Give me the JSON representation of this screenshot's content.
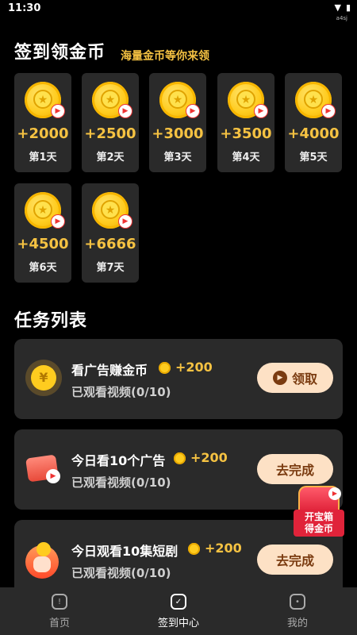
{
  "status": {
    "time": "11:30",
    "wifi_icon": "wifi-icon",
    "battery_icon": "battery-icon",
    "small_text": "a4sj"
  },
  "checkin": {
    "title": "签到领金币",
    "subtitle": "海量金币等你来领",
    "days": [
      {
        "amount": "+2000",
        "label": "第1天"
      },
      {
        "amount": "+2500",
        "label": "第2天"
      },
      {
        "amount": "+3000",
        "label": "第3天"
      },
      {
        "amount": "+3500",
        "label": "第4天"
      },
      {
        "amount": "+4000",
        "label": "第5天"
      },
      {
        "amount": "+4500",
        "label": "第6天"
      },
      {
        "amount": "+6666",
        "label": "第7天"
      }
    ]
  },
  "tasks": {
    "title": "任务列表",
    "items": [
      {
        "title": "看广告赚金币",
        "reward": "+200",
        "progress": "已观看视频(0/10)",
        "button": "领取",
        "icon": "yuan-coin-icon"
      },
      {
        "title": "今日看10个广告",
        "reward": "+200",
        "progress": "已观看视频(0/10)",
        "button": "去完成",
        "icon": "video-ad-icon"
      },
      {
        "title": "今日观看10集短剧",
        "reward": "+200",
        "progress": "已观看视频(0/10)",
        "button": "去完成",
        "icon": "hand-coin-icon"
      }
    ]
  },
  "treasure": {
    "line1": "开宝箱",
    "line2": "得金币"
  },
  "nav": [
    {
      "label": "首页",
      "icon": "home-icon"
    },
    {
      "label": "签到中心",
      "icon": "calendar-check-icon"
    },
    {
      "label": "我的",
      "icon": "profile-icon"
    }
  ],
  "colors": {
    "accent": "#f5c242",
    "card": "#2a2a2a",
    "button": "#fde1c5",
    "button_text": "#7a3b10"
  }
}
